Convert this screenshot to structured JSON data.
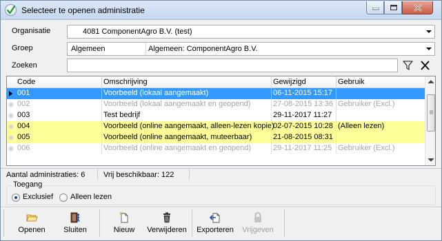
{
  "window": {
    "title": "Selecteer te openen administratie",
    "icon": "check-circle-icon"
  },
  "form": {
    "organisatie_label": "Organisatie",
    "organisatie_value": "4081  ComponentAgro B.V. (test)",
    "groep_label": "Groep",
    "groep_code": "Algemeen",
    "groep_name": "Algemeen: ComponentAgro B.V.",
    "zoeken_label": "Zoeken",
    "zoeken_value": ""
  },
  "grid": {
    "columns": [
      "Code",
      "Omschrijving",
      "Gewijzigd",
      "Gebruik"
    ],
    "rows": [
      {
        "code": "001",
        "omschrijving": "Voorbeeld (lokaal aangemaakt)",
        "gewijzigd": "06-11-2015 15:17",
        "gebruik": "",
        "state": "selected"
      },
      {
        "code": "002",
        "omschrijving": "Voorbeeld (lokaal aangemaakt en geopend)",
        "gewijzigd": "27-08-2015 13:36",
        "gebruik": "Gebruiker (Excl.)",
        "state": "gray"
      },
      {
        "code": "003",
        "omschrijving": "Test bedrijf",
        "gewijzigd": "29-11-2017 11:27",
        "gebruik": "",
        "state": "normal"
      },
      {
        "code": "004",
        "omschrijving": "Voorbeeld (online aangemaakt, alleen-lezen kopie)",
        "gewijzigd": "02-07-2015 10:28",
        "gebruik": "(Alleen lezen)",
        "state": "yellow"
      },
      {
        "code": "005",
        "omschrijving": "Voorbeeld (online aangemaakt, muteerbaar)",
        "gewijzigd": "21-08-2015 08:31",
        "gebruik": "",
        "state": "yellow"
      },
      {
        "code": "006",
        "omschrijving": "Voorbeeld (online aangemaakt en geopend)",
        "gewijzigd": "29-11-2017 11:25",
        "gebruik": "Gebruiker (Excl.)",
        "state": "gray"
      }
    ]
  },
  "status": {
    "aantal": "Aantal administraties: 6",
    "vrij": "Vrij beschikbaar: 122"
  },
  "toegang": {
    "title": "Toegang",
    "options": [
      "Exclusief",
      "Alleen lezen"
    ],
    "selected": "Exclusief"
  },
  "toolbar": {
    "buttons": [
      {
        "label": "Openen",
        "icon": "folder-open-icon",
        "enabled": true
      },
      {
        "label": "Sluiten",
        "icon": "exit-door-icon",
        "enabled": true
      },
      {
        "label": "Nieuw",
        "icon": "new-document-icon",
        "enabled": true
      },
      {
        "label": "Verwijderen",
        "icon": "trash-icon",
        "enabled": true
      },
      {
        "label": "Exporteren",
        "icon": "export-icon",
        "enabled": true
      },
      {
        "label": "Vrijgeven",
        "icon": "lock-icon",
        "enabled": false
      }
    ]
  },
  "colors": {
    "selection": "#3399ff",
    "highlight_yellow": "#ffff99",
    "disabled_text": "#a5a5a5"
  }
}
